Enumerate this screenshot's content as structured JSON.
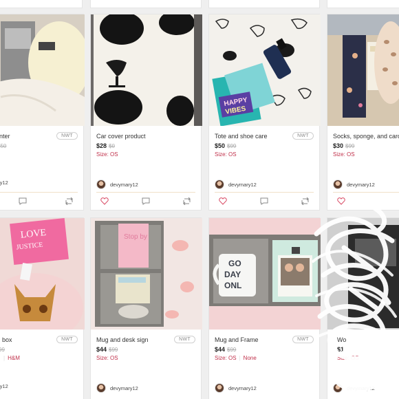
{
  "badge_label": "NWT",
  "seller_name": "devymary12",
  "listings": [
    {
      "title": "nter",
      "price": "",
      "orig_price": "$50",
      "size_label": "",
      "size_value": "",
      "brand": ""
    },
    {
      "title": "Car cover product",
      "price": "$28",
      "orig_price": "$0",
      "size_label": "Size:",
      "size_value": "OS",
      "brand": ""
    },
    {
      "title": "Tote and shoe care",
      "price": "$50",
      "orig_price": "$99",
      "size_label": "Size:",
      "size_value": "OS",
      "brand": ""
    },
    {
      "title": "Socks, sponge, and card",
      "price": "$30",
      "orig_price": "$99",
      "size_label": "Size:",
      "size_value": "OS",
      "brand": ""
    },
    {
      "title": "box",
      "price": "",
      "orig_price": "99",
      "size_label": "",
      "size_value": "",
      "brand": "H&M"
    },
    {
      "title": "Mug and desk sign",
      "price": "$44",
      "orig_price": "$99",
      "size_label": "Size:",
      "size_value": "OS",
      "brand": ""
    },
    {
      "title": "Mug and Frame",
      "price": "$44",
      "orig_price": "$99",
      "size_label": "Size:",
      "size_value": "OS",
      "brand": "None"
    },
    {
      "title": "Wo",
      "price": "$1",
      "orig_price": "",
      "size_label": "Size:",
      "size_value": "OS",
      "brand": ""
    }
  ],
  "image_text": {
    "love_justice_line1": "LOVE",
    "love_justice_line2": "JUSTICE",
    "happy_vibes_line1": "HAPPY",
    "happy_vibes_line2": "VIBES",
    "mug_line1": "GO",
    "mug_line2": "DAY",
    "mug_line3": "ONL",
    "stop_sign": "Stop by"
  },
  "icons": [
    "heart-icon",
    "comment-icon",
    "share-icon"
  ],
  "colors": {
    "price_accent": "#c0304a",
    "badge_border": "#cfcfcf",
    "divider": "#f0e0c8"
  }
}
